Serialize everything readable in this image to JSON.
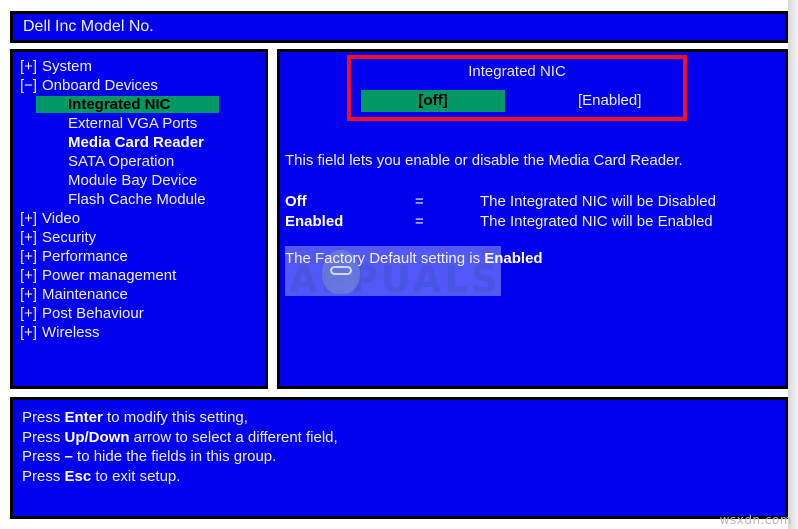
{
  "window": {
    "title": "Dell Inc Model No."
  },
  "nav": {
    "items": [
      {
        "prefix": "[+]",
        "label": "System",
        "level": 1,
        "style": "normal"
      },
      {
        "prefix": "[−]",
        "label": "Onboard Devices",
        "level": 1,
        "style": "normal"
      },
      {
        "prefix": "",
        "label": "Integrated NIC",
        "level": 2,
        "style": "selected"
      },
      {
        "prefix": "",
        "label": "External VGA Ports",
        "level": 2,
        "style": "normal"
      },
      {
        "prefix": "",
        "label": "Media Card Reader",
        "level": 2,
        "style": "bold"
      },
      {
        "prefix": "",
        "label": "SATA Operation",
        "level": 2,
        "style": "normal"
      },
      {
        "prefix": "",
        "label": "Module Bay Device",
        "level": 2,
        "style": "normal"
      },
      {
        "prefix": "",
        "label": "Flash Cache Module",
        "level": 2,
        "style": "normal"
      },
      {
        "prefix": "[+]",
        "label": "Video",
        "level": 1,
        "style": "normal"
      },
      {
        "prefix": "[+]",
        "label": "Security",
        "level": 1,
        "style": "normal"
      },
      {
        "prefix": "[+]",
        "label": "Performance",
        "level": 1,
        "style": "normal"
      },
      {
        "prefix": "[+]",
        "label": "Power management",
        "level": 1,
        "style": "normal"
      },
      {
        "prefix": "[+]",
        "label": "Maintenance",
        "level": 1,
        "style": "normal"
      },
      {
        "prefix": "[+]",
        "label": "Post Behaviour",
        "level": 1,
        "style": "normal"
      },
      {
        "prefix": "[+]",
        "label": "Wireless",
        "level": 1,
        "style": "normal"
      }
    ]
  },
  "detail": {
    "option_title": "Integrated NIC",
    "option_off_label": "[off]",
    "option_enabled_label": "[Enabled]",
    "description": "This field lets you enable or disable the Media Card Reader.",
    "values": [
      {
        "name": "Off",
        "eq": "=",
        "desc": "The Integrated NIC will be Disabled"
      },
      {
        "name": "Enabled",
        "eq": "=",
        "desc": "The Integrated NIC will be Enabled"
      }
    ],
    "factory_default_prefix": "The Factory Default setting is ",
    "factory_default_value": "Enabled"
  },
  "help": {
    "lines": [
      {
        "pre": "Press ",
        "key": "Enter",
        "post": " to modify this setting,"
      },
      {
        "pre": "Press ",
        "key": "Up/Down",
        "post": " arrow to select a different field,"
      },
      {
        "pre": "Press ",
        "key": "–",
        "post": " to hide the fields in this group."
      },
      {
        "pre": "Press ",
        "key": "Esc",
        "post": " to exit setup."
      }
    ]
  },
  "watermark": {
    "logo_text": "APPUALS",
    "site": "wsxdn.com"
  },
  "colors": {
    "panel_blue": "#0000ee",
    "highlight_green": "#009966",
    "red_border": "#ee1122",
    "text": "#f0f0f0"
  }
}
